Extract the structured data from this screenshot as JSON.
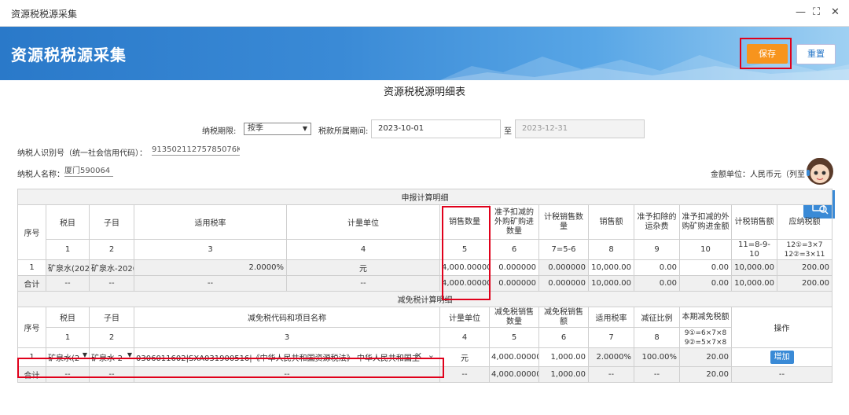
{
  "window": {
    "title": "资源税税源采集",
    "minimize": "—",
    "maximize": "⛶",
    "close": "✕"
  },
  "banner": {
    "title": "资源税税源采集",
    "save_label": "保存",
    "reset_label": "重置"
  },
  "report_title": "资源税税源明细表",
  "form": {
    "period_label": "纳税期限:",
    "period_value": "按季",
    "belong_label": "税款所属期间:",
    "start_date": "2023-10-01",
    "to_label": "至",
    "end_date": "2023-12-31",
    "taxpayer_id_label": "纳税人识别号（统一社会信用代码）：",
    "taxpayer_id_value": "91350211275785076K",
    "taxpayer_name_label": "纳税人名称：",
    "taxpayer_name_value": "厦门590064",
    "amount_unit": "金额单位：人民币元（列至"
  },
  "declare": {
    "section_title": "申报计算明细",
    "headers": [
      "序号",
      "税目",
      "子目",
      "适用税率",
      "计量单位",
      "销售数量",
      "准予扣减的外购矿购进数量",
      "计税销售数量",
      "销售额",
      "准予扣除的运杂费",
      "准予扣减的外购矿购进金额",
      "计税销售额",
      "应纳税额"
    ],
    "index_row": [
      "1",
      "2",
      "3",
      "4",
      "5",
      "6",
      "7=5-6",
      "8",
      "9",
      "10",
      "11=8-9-10",
      "12①=3×7\n12②=3×11"
    ],
    "row": {
      "seq": "1",
      "item": "矿泉水(2020",
      "subitem": "矿泉水-2020",
      "rate": "2.0000%",
      "unit": "元",
      "qty": "4,000.000000",
      "deduct_qty": "0.000000",
      "taxable_qty": "0.000000",
      "sales": "10,000.00",
      "freight": "0.00",
      "deduct_amt": "0.00",
      "taxable_sales": "10,000.00",
      "tax": "200.00"
    },
    "sum": {
      "label": "合计",
      "item": "--",
      "subitem": "--",
      "rate": "--",
      "unit": "--",
      "qty": "4,000.000000",
      "deduct_qty": "0.000000",
      "taxable_qty": "0.000000",
      "sales": "10,000.00",
      "freight": "0.00",
      "deduct_amt": "0.00",
      "taxable_sales": "10,000.00",
      "tax": "200.00"
    }
  },
  "relief": {
    "section_title": "减免税计算明细",
    "headers": [
      "序号",
      "税目",
      "子目",
      "减免税代码和项目名称",
      "计量单位",
      "减免税销售数量",
      "减免税销售额",
      "适用税率",
      "减征比例",
      "本期减免税额",
      "操作"
    ],
    "index_row": [
      "1",
      "2",
      "3",
      "4",
      "5",
      "6",
      "7",
      "8",
      "9①=6×7×8\n9②=5×7×8"
    ],
    "row": {
      "seq": "1",
      "item": "矿泉水(2",
      "subitem": "矿泉水-2",
      "code_name": "0306011602|SXA031900516|《中华人民共和国资源税法》 中华人民共和国主",
      "unit": "元",
      "qty": "4,000.000000",
      "sales": "1,000.00",
      "rate": "2.0000%",
      "ratio": "100.00%",
      "amount": "20.00",
      "add_label": "增加"
    },
    "sum": {
      "label": "合计",
      "item": "--",
      "subitem": "--",
      "code_name": "--",
      "unit": "--",
      "qty": "4,000.000000",
      "sales": "1,000.00",
      "rate": "--",
      "ratio": "--",
      "amount": "20.00",
      "op": "--"
    }
  },
  "colors": {
    "banner": "#2a79c9",
    "save": "#f7941d",
    "highlight": "#e0001b"
  }
}
